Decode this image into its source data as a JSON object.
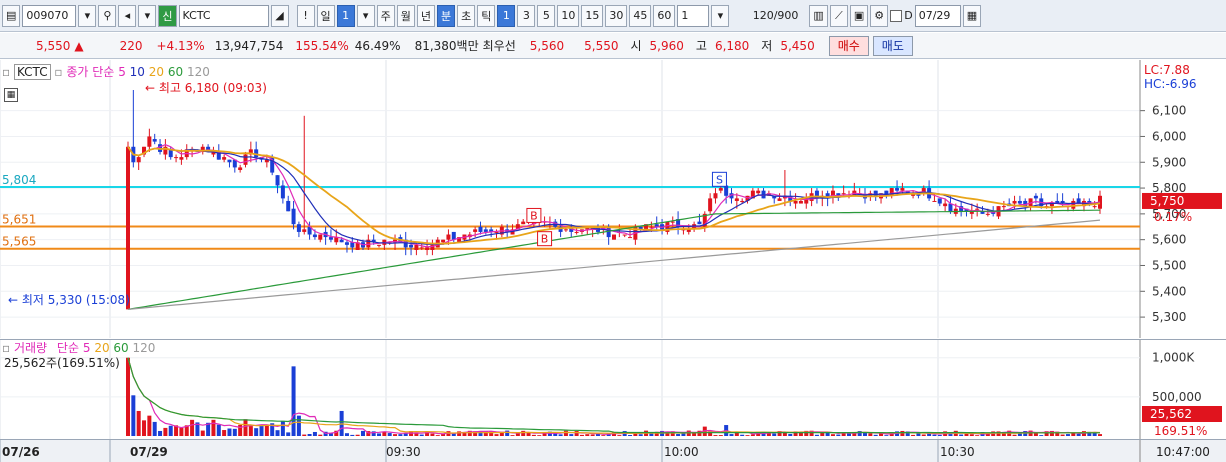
{
  "toolbar": {
    "code": "009070",
    "name_badge": "신",
    "name": "KCTC",
    "excl": "!",
    "period_day": "일",
    "period_count": "1",
    "periods": [
      "주",
      "월",
      "년"
    ],
    "period_min": "분",
    "period_sec": "초",
    "period_tick": "틱",
    "intervals": [
      "1",
      "3",
      "5",
      "10",
      "15",
      "30",
      "45",
      "60"
    ],
    "interval_sel": "1",
    "count": "120",
    "count_total": "/900",
    "check_label": "D",
    "date": "07/29"
  },
  "info": {
    "price": "5,550",
    "arrow": "▲",
    "change": "220",
    "change_pct": "+4.13%",
    "volume": "13,947,754",
    "vol_ratio": "155.54%",
    "turnover": "46.49%",
    "amount": "81,380백만",
    "pref_label": "최우선",
    "ask": "5,560",
    "bid": "5,550",
    "open_label": "시",
    "open": "5,960",
    "high_label": "고",
    "high": "6,180",
    "low_label": "저",
    "low": "5,450",
    "buy": "매수",
    "sell": "매도"
  },
  "price_legend": {
    "name": "KCTC",
    "label": "종가 단순",
    "mas": [
      "5",
      "10",
      "20",
      "60",
      "120"
    ],
    "high_note": "최고 6,180 (09:03)",
    "low_note": "최저 5,330 (15:08)",
    "lc": "LC:7.88",
    "hc": "HC:-6.96"
  },
  "volume_legend": {
    "label": "거래량",
    "ma_label": "단순",
    "mas": [
      "5",
      "20",
      "60",
      "120"
    ],
    "last": "25,562주(169.51%)"
  },
  "price_axis": {
    "ticks": [
      "6,100",
      "6,000",
      "5,900",
      "5,800",
      "5,700",
      "5,600",
      "5,500",
      "5,400",
      "5,300"
    ],
    "current": "5,750",
    "current_pct": "0.17%",
    "levels": [
      {
        "label": "5,804",
        "value": 5804,
        "color": "#19d6e8"
      },
      {
        "label": "5,651",
        "value": 5651,
        "color": "#f08a18"
      },
      {
        "label": "5,565",
        "value": 5565,
        "color": "#f08a18"
      }
    ],
    "signals": [
      "S",
      "B",
      "B"
    ]
  },
  "volume_axis": {
    "ticks": [
      "1,000K",
      "500,000"
    ],
    "current": "25,562",
    "current_pct": "169.51%"
  },
  "x_axis": {
    "labels": [
      "07/26",
      "07/29",
      "09:30",
      "10:00",
      "10:30",
      "10:47:00"
    ]
  },
  "colors": {
    "up": "#e0141e",
    "down": "#1a3fd6",
    "ma5": "#e02bb8",
    "ma10": "#1f2fb8",
    "ma20": "#e8a51a",
    "ma60": "#2a9a3a",
    "ma120": "#9a9a9a"
  },
  "chart_data": {
    "type": "candlestick",
    "ylim": [
      5250,
      6180
    ],
    "candles_sample": [
      {
        "t": "09:01",
        "o": 5330,
        "h": 6180,
        "l": 5330,
        "c": 5960
      },
      {
        "t": "09:05",
        "o": 6000,
        "h": 6050,
        "l": 5880,
        "c": 5900
      },
      {
        "t": "09:15",
        "o": 5900,
        "h": 5950,
        "l": 5850,
        "c": 5920
      },
      {
        "t": "09:22",
        "o": 5880,
        "h": 6080,
        "l": 5620,
        "c": 5650
      },
      {
        "t": "09:30",
        "o": 5620,
        "h": 5650,
        "l": 5570,
        "c": 5600
      },
      {
        "t": "09:45",
        "o": 5600,
        "h": 5640,
        "l": 5580,
        "c": 5610
      },
      {
        "t": "10:00",
        "o": 5650,
        "h": 5670,
        "l": 5620,
        "c": 5640
      },
      {
        "t": "10:15",
        "o": 5660,
        "h": 5810,
        "l": 5650,
        "c": 5790
      },
      {
        "t": "10:30",
        "o": 5790,
        "h": 5810,
        "l": 5760,
        "c": 5770
      },
      {
        "t": "10:45",
        "o": 5730,
        "h": 5760,
        "l": 5710,
        "c": 5750
      }
    ]
  }
}
